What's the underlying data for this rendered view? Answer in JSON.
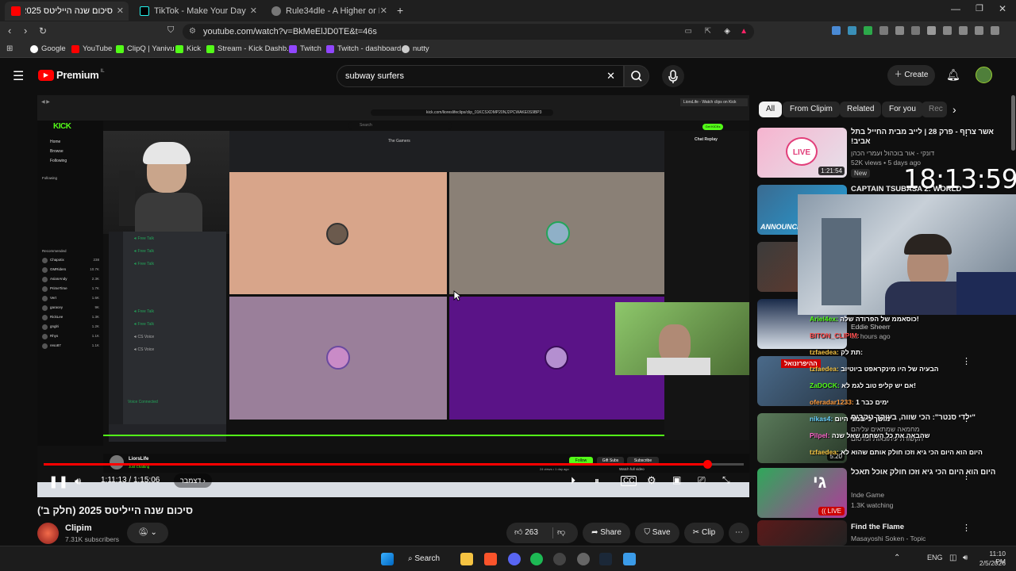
{
  "browser": {
    "tabs": [
      {
        "title": "סיכום שנה הייליטס 2025 (חל"
      },
      {
        "title": "TikTok - Make Your Day"
      },
      {
        "title": "Rule34dle - A Higher or Lower G"
      }
    ],
    "url": "youtube.com/watch?v=BkMeElJD0TE&t=46s",
    "bookmarks": [
      "Google",
      "YouTube",
      "ClipQ | Yanivu",
      "Kick",
      "Stream - Kick Dashb...",
      "Twitch",
      "Twitch - dashboard",
      "nutty"
    ]
  },
  "youtube": {
    "logo": "Premium",
    "logo_region": "IL",
    "search_value": "subway surfers",
    "create_label": "Create"
  },
  "player": {
    "time_current": "1:11:13",
    "time_total": "1:15:06",
    "chapter": "דצמבר",
    "progress": 0.948,
    "overlay_clock": "18:13:59",
    "inner": {
      "url": "kick.com/lioreslifeclips/clip_01KCSXDMP20NJ2PCWAKE0S9BP3",
      "tab_title": "LiorsLife - Watch clips on Kick",
      "nav": [
        "Home",
        "Browse",
        "Following"
      ],
      "following_label": "Following",
      "recommended_label": "Recommended",
      "channels": [
        "Chapotix",
        "GMRiders",
        "AsianAndy",
        "PrimeTime",
        "Vert",
        "garacey",
        "RickLee",
        "gnglri",
        "Rhys",
        "reso87"
      ],
      "viewers": [
        "238",
        "10.7K",
        "2.3K",
        "1.7K",
        "1.6K",
        "9K",
        "1.3K",
        "1.2K",
        "1.1K",
        "1.1K"
      ],
      "voice_channels": [
        "Free Talk",
        "Free Talk",
        "Free Talk",
        "Free Talk",
        "Free Talk",
        "CS Voice",
        "CS Voice"
      ],
      "voice_connected": "Voice Connected",
      "call_name": "The Gamers",
      "chat_replay": "Chat Replay",
      "streamer": "LiorsLife",
      "stream_status": "Just Chatting",
      "follow": "Follow",
      "gift_subs": "Gift Subs",
      "subscribe": "Subscribe",
      "watch_full": "Watch full video",
      "views_meta": "24 views • 1 day ago",
      "search_placeholder": "Search",
      "get_kicks": "Get KICKs"
    }
  },
  "video": {
    "title": "סיכום שנה הייליטס 2025 (חלק ב')",
    "channel": "Clipim",
    "subscribers": "7.31K subscribers",
    "likes": "263",
    "share": "Share",
    "save": "Save",
    "clip": "Clip"
  },
  "chips": [
    "All",
    "From Clipim",
    "Related",
    "For you",
    "Rec"
  ],
  "recommendations": [
    {
      "title": "אשר צרוף - פרק 28 | לייב מבית החייל בתל אביב!",
      "channel": "דונקי - אור בוכהול ועמרי הכהן",
      "meta": "52K views • 5 days ago",
      "badge": "New",
      "duration": "1:21:54",
      "thumb_text": "LIVE"
    },
    {
      "title": "CAPTAIN TSUBASA 2: WORLD",
      "channel": "",
      "meta": "",
      "badge": "",
      "duration": "",
      "thumb_text": "ANNOUNCE"
    },
    {
      "title": "ואלה כל הכסף לך ששמת סטרימים קטנים",
      "channel": "Eddie Sheerr",
      "meta": "22 hours ago",
      "badge": "",
      "duration": "",
      "thumb_text": ""
    },
    {
      "title": "הנצגר ודשח תרצבל ירצב הזפזף",
      "channel": "",
      "meta": "",
      "badge": "",
      "duration": "",
      "thumb_text": "ההיפרזנואל"
    },
    {
      "title": "\"ילדי סנטר\": הכי שווה, בעיקר נוקבים",
      "channel": "מחמאה שמתאים עליהם",
      "meta": "תקשורת עיתונאות ופרסום",
      "badge": "",
      "duration": "5:20",
      "thumb_text": ""
    },
    {
      "title": "היום הוא היום הכי גיא וזכו חולק אוכל תאכל",
      "channel": "Inde Game",
      "meta": "1.3K watching",
      "badge": "LIVE",
      "duration": "",
      "thumb_text": "גי"
    },
    {
      "title": "Find the Flame",
      "channel": "Masayoshi Soken - Topic",
      "meta": "",
      "badge": "",
      "duration": "",
      "thumb_text": ""
    }
  ],
  "chat_overlay": [
    {
      "user": "Ariel4ex",
      "text": "כוסאממ של הפרודה שלה!"
    },
    {
      "user": "BITON_CLIPIM",
      "text": ""
    },
    {
      "user": "tzfaedea",
      "text": "תת לק:"
    },
    {
      "user": "tzfaedea",
      "text": "הבעיה של היו מינקראפט ביוטיוב"
    },
    {
      "user": "ZaDOCK",
      "text": "אם יש קליפ טוב לגמ לא!"
    },
    {
      "user": "oferadar1233",
      "text": "ימים כבר 1"
    },
    {
      "user": "nikas4",
      "text": "מושך כי במני היום"
    },
    {
      "user": "Pilpel",
      "text": "שהבאה את כל השחמו שאל שנה"
    },
    {
      "user": "tzfaedea",
      "text": "היום הוא היום הכי גיא וזכו חולק אותם שהוא לא"
    }
  ],
  "taskbar": {
    "search": "Search",
    "lang": "ENG",
    "time": "11:10 PM",
    "date": "2/5/2026"
  },
  "colors": {
    "accent": "#ff0000",
    "purple": "#5a1387",
    "peach": "#d8a58a",
    "kick_green": "#53fc18"
  }
}
